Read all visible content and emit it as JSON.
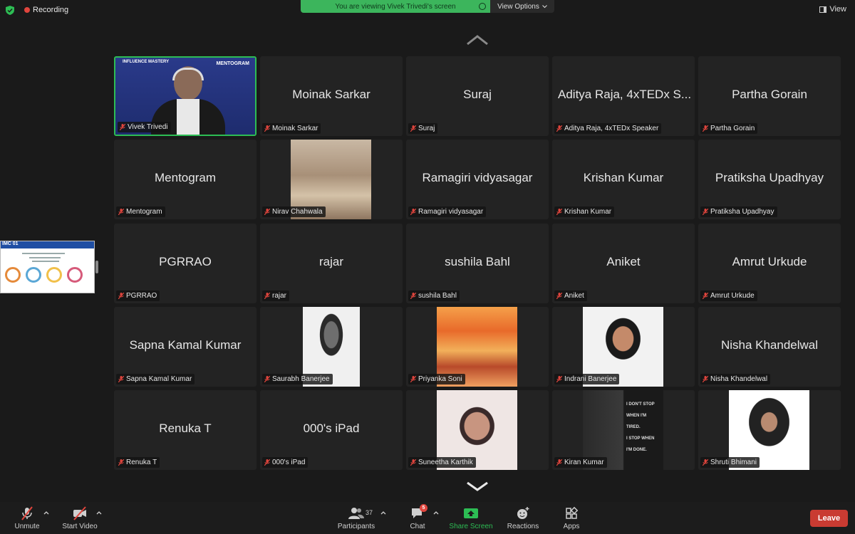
{
  "topbar": {
    "recording_label": "Recording",
    "viewing_text": "You are viewing Vivek Trivedi's screen",
    "view_options_label": "View Options",
    "view_label": "View"
  },
  "shared_thumbnail": {
    "header": "IMC 01"
  },
  "tiles": [
    {
      "name": "Vivek Trivedi",
      "big": "",
      "overlay": [
        "INFLUENCE MASTERY",
        "MENTOGRAM"
      ]
    },
    {
      "name": "Moinak Sarkar",
      "big": "Moinak Sarkar"
    },
    {
      "name": "Suraj",
      "big": "Suraj"
    },
    {
      "name": "Aditya Raja, 4xTEDx Speaker",
      "big": "Aditya Raja, 4xTEDx S..."
    },
    {
      "name": "Partha Gorain",
      "big": "Partha Gorain"
    },
    {
      "name": "Mentogram",
      "big": "Mentogram"
    },
    {
      "name": "Nirav Chahwala",
      "big": ""
    },
    {
      "name": "Ramagiri vidyasagar",
      "big": "Ramagiri vidyasagar"
    },
    {
      "name": "Krishan Kumar",
      "big": "Krishan Kumar"
    },
    {
      "name": "Pratiksha Upadhyay",
      "big": "Pratiksha Upadhyay"
    },
    {
      "name": "PGRRAO",
      "big": "PGRRAO"
    },
    {
      "name": "rajar",
      "big": "rajar"
    },
    {
      "name": "sushila Bahl",
      "big": "sushila Bahl"
    },
    {
      "name": "Aniket",
      "big": "Aniket"
    },
    {
      "name": "Amrut Urkude",
      "big": "Amrut Urkude"
    },
    {
      "name": "Sapna Kamal Kumar",
      "big": "Sapna Kamal Kumar"
    },
    {
      "name": "Saurabh Banerjee",
      "big": ""
    },
    {
      "name": "Priyanka Soni",
      "big": ""
    },
    {
      "name": "Indrani Banerjee",
      "big": ""
    },
    {
      "name": "Nisha Khandelwal",
      "big": "Nisha Khandelwal"
    },
    {
      "name": "Renuka T",
      "big": "Renuka T"
    },
    {
      "name": "000's iPad",
      "big": "000's iPad"
    },
    {
      "name": "Suneetha Karthik",
      "big": ""
    },
    {
      "name": "Kiran Kumar",
      "big": "",
      "poster": [
        "I DON'T STOP",
        "WHEN I'M",
        "TIRED.",
        "I STOP WHEN",
        "I'M DONE."
      ]
    },
    {
      "name": "Shruti Bhimani",
      "big": ""
    }
  ],
  "toolbar": {
    "unmute": "Unmute",
    "start_video": "Start Video",
    "participants": "Participants",
    "participants_count": "37",
    "chat": "Chat",
    "chat_badge": "5",
    "share_screen": "Share Screen",
    "reactions": "Reactions",
    "apps": "Apps",
    "leave": "Leave"
  },
  "colors": {
    "share_green": "#2dbd54",
    "leave_red": "#c93b32",
    "tile_bg": "#232323"
  }
}
